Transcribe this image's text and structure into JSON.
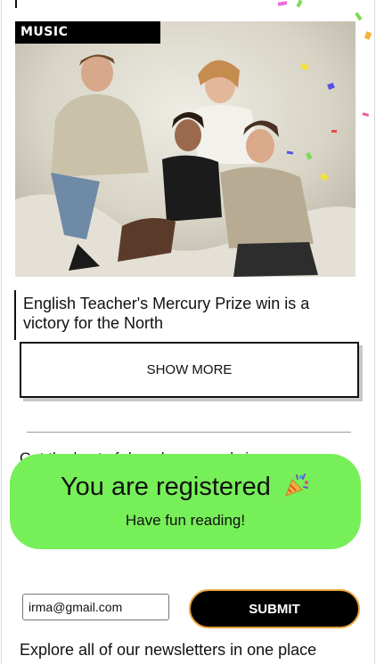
{
  "article": {
    "category": "MUSIC",
    "headline": "English Teacher's Mercury Prize win is a victory for the North"
  },
  "buttons": {
    "show_more": "SHOW MORE",
    "submit": "SUBMIT"
  },
  "newsletter": {
    "partial_text": "Get the best of dazed news and view",
    "email_value": "irma@gmail.com",
    "explore_text": "Explore all of our newsletters in one place"
  },
  "toast": {
    "title": "You are registered",
    "subtitle": "Have fun reading!",
    "icon": "party-popper-icon"
  },
  "colors": {
    "toast_bg": "#76ef58",
    "submit_border": "#e8a13a",
    "tag_bg": "#000000"
  }
}
